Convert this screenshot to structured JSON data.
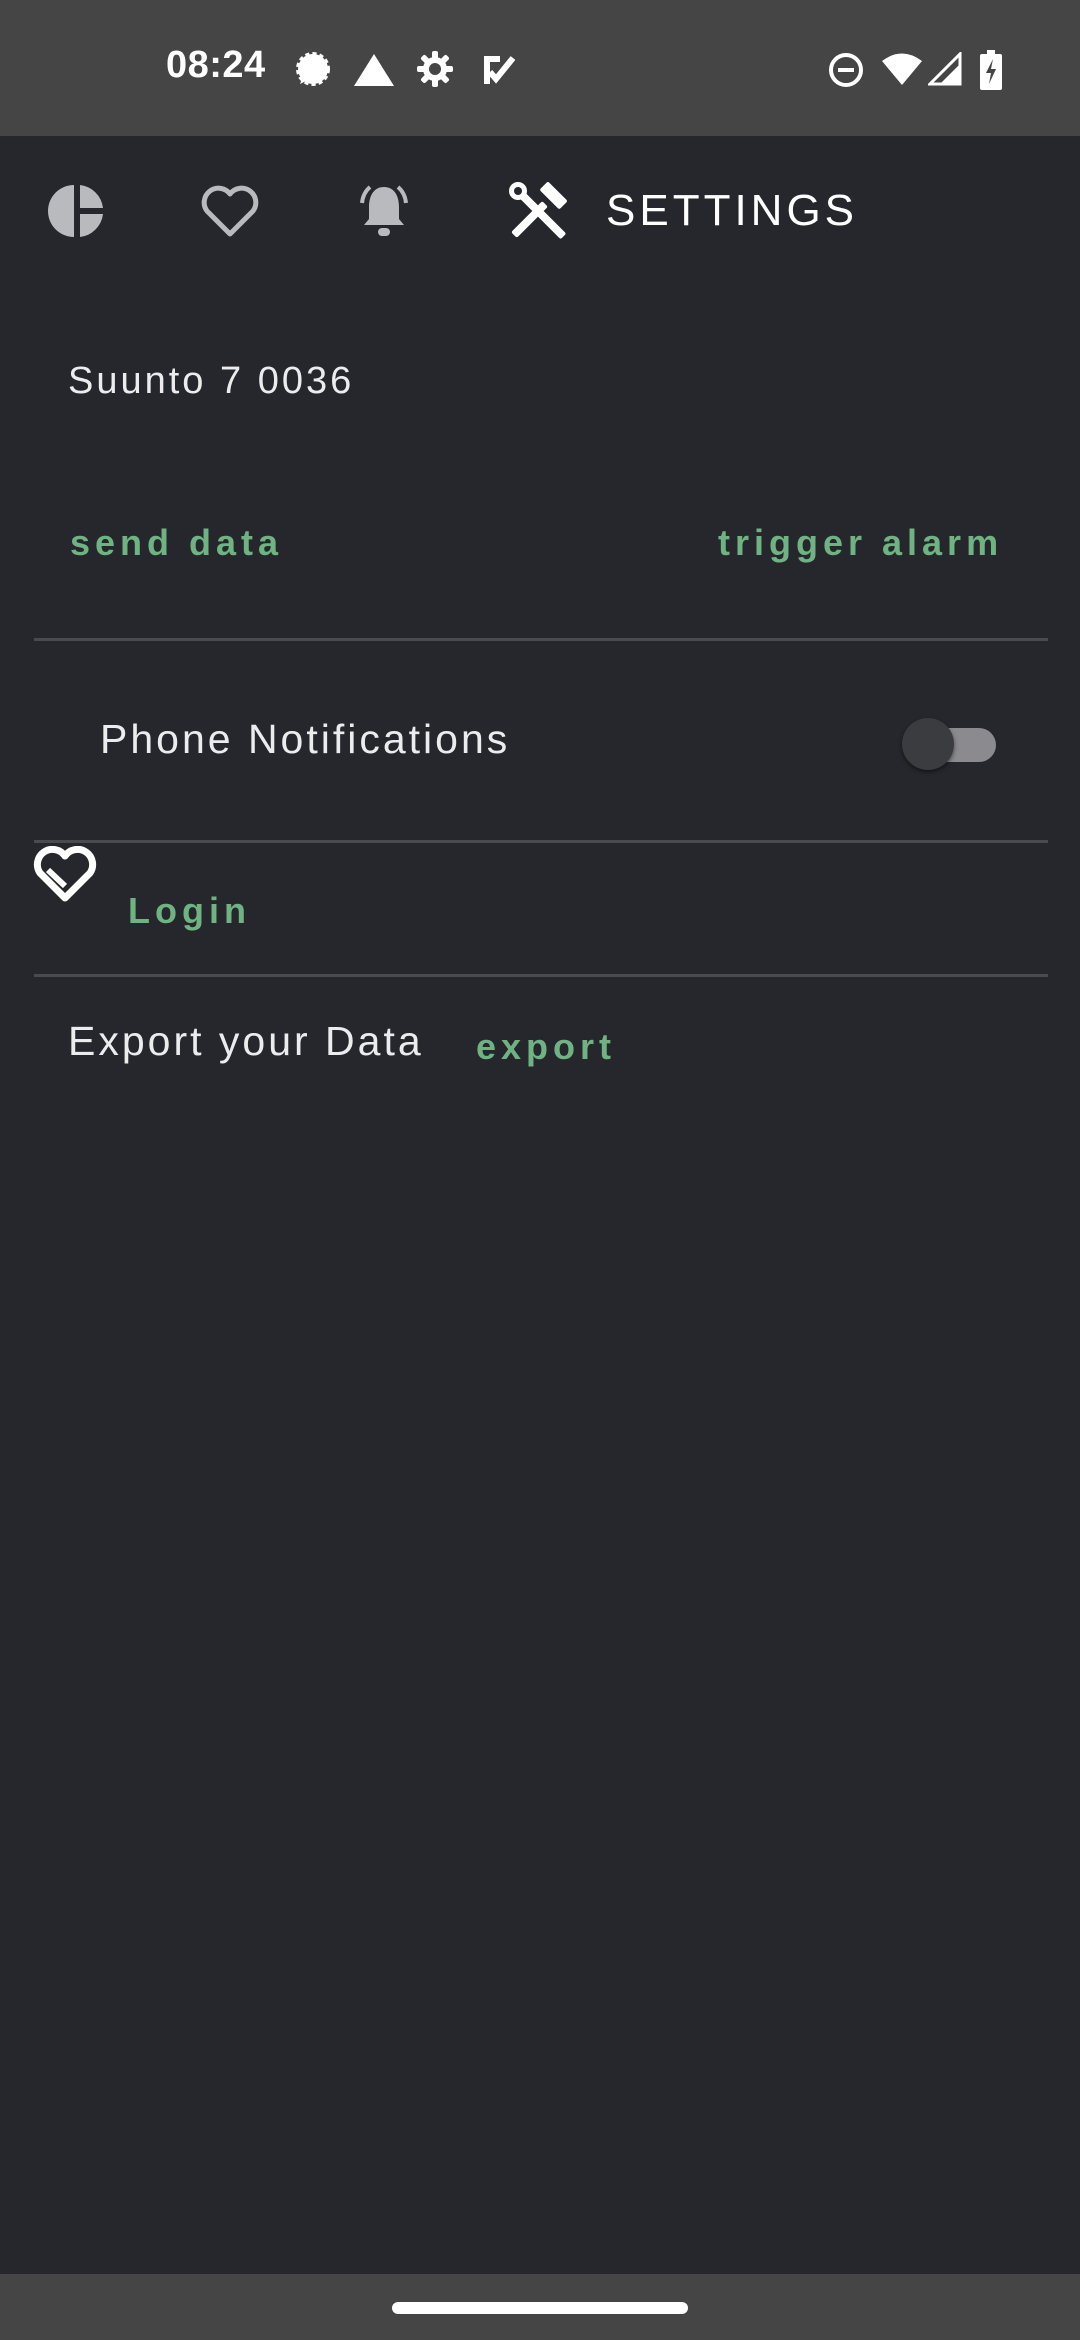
{
  "status_bar": {
    "time": "08:24",
    "left_icons": [
      "signal-messenger-icon",
      "warning-triangle-icon",
      "settings-gear-icon",
      "task-check-icon"
    ],
    "right_icons": [
      "do-not-disturb-icon",
      "wifi-icon",
      "cell-signal-icon",
      "battery-charging-icon"
    ]
  },
  "tabs": [
    {
      "name": "stats",
      "icon": "pie-chart-icon",
      "active": false
    },
    {
      "name": "favorites",
      "icon": "heart-icon",
      "active": false
    },
    {
      "name": "alerts",
      "icon": "bell-icon",
      "active": false
    },
    {
      "name": "settings",
      "icon": "tools-icon",
      "active": true,
      "label": "SETTINGS"
    }
  ],
  "device": {
    "name": "Suunto 7 0036",
    "send_label": "send data",
    "alarm_label": "trigger alarm"
  },
  "notifications": {
    "label": "Phone Notifications",
    "enabled": false
  },
  "health": {
    "icon": "health-heart-icon",
    "login_label": "Login"
  },
  "export": {
    "label": "Export your Data",
    "button_label": "export"
  },
  "colors": {
    "background": "#26272c",
    "accent": "#6fb383",
    "system_bar": "#454545"
  }
}
